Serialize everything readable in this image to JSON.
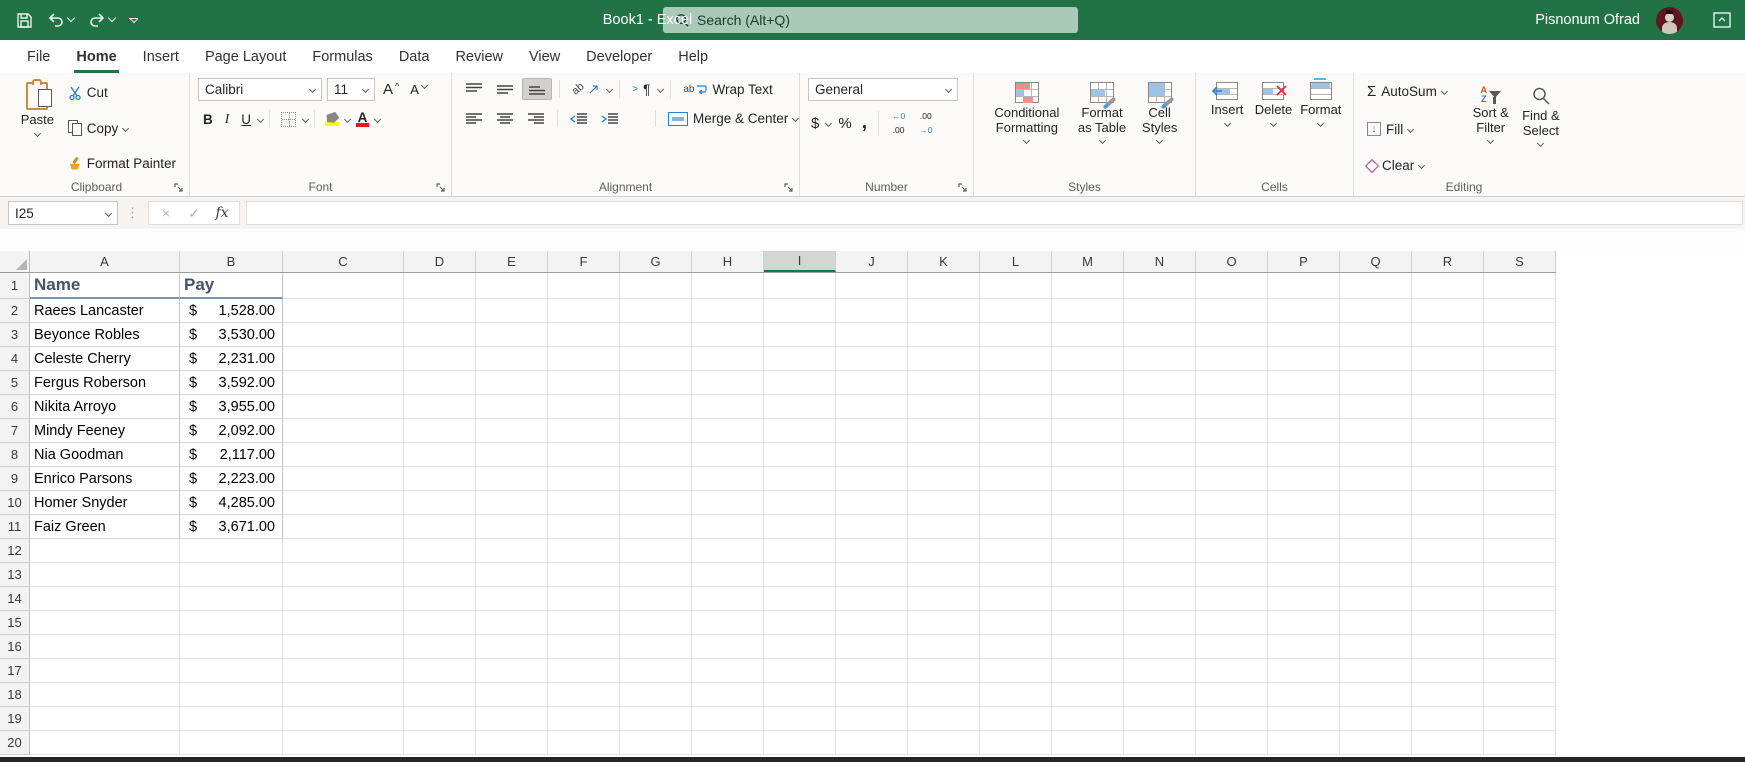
{
  "titlebar": {
    "title": "Book1  -  Excel",
    "search_placeholder": "Search (Alt+Q)",
    "user_name": "Pisnonum Ofrad"
  },
  "tabs": {
    "active": "Home",
    "items": [
      {
        "label": "File"
      },
      {
        "label": "Home"
      },
      {
        "label": "Insert"
      },
      {
        "label": "Page Layout"
      },
      {
        "label": "Formulas"
      },
      {
        "label": "Data"
      },
      {
        "label": "Review"
      },
      {
        "label": "View"
      },
      {
        "label": "Developer"
      },
      {
        "label": "Help"
      }
    ]
  },
  "ribbon": {
    "clipboard": {
      "label": "Clipboard",
      "paste": "Paste",
      "cut": "Cut",
      "copy": "Copy",
      "format_painter": "Format Painter"
    },
    "font": {
      "label": "Font",
      "font_name": "Calibri",
      "font_size": "11"
    },
    "alignment": {
      "label": "Alignment",
      "wrap_text": "Wrap Text",
      "merge_center": "Merge & Center"
    },
    "number": {
      "label": "Number",
      "format": "General"
    },
    "styles": {
      "label": "Styles",
      "conditional_formatting": "Conditional Formatting",
      "format_as_table": "Format as Table",
      "cell_styles": "Cell Styles"
    },
    "cells": {
      "label": "Cells",
      "insert": "Insert",
      "delete": "Delete",
      "format": "Format"
    },
    "editing": {
      "label": "Editing",
      "autosum": "AutoSum",
      "fill": "Fill",
      "clear": "Clear",
      "sort_filter": "Sort & Filter",
      "find_select": "Find & Select"
    }
  },
  "icons": {
    "bold": "B",
    "italic": "I",
    "underline": "U",
    "grow_font": "A",
    "shrink_font": "A",
    "font_color_letter": "A",
    "orientation_text": "ab",
    "pilcrow": "¶",
    "wrap_ab": "ab",
    "currency": "$",
    "percent": "%",
    "comma": ",",
    "inc_dec_top": "←0",
    "inc_dec_bottom": ".00",
    "dec_dec_top": ".00",
    "dec_dec_bottom": "→0",
    "autosum_sigma": "Σ",
    "fill_arrow": "↓",
    "sort_a": "A",
    "sort_z": "Z",
    "cancel": "×",
    "enter": "✓",
    "fx": "fx"
  },
  "formula_bar": {
    "name_box": "I25",
    "formula_value": ""
  },
  "grid": {
    "column_headers": [
      "A",
      "B",
      "C",
      "D",
      "E",
      "F",
      "G",
      "H",
      "I",
      "J",
      "K",
      "L",
      "M",
      "N",
      "O",
      "P",
      "Q",
      "R",
      "S"
    ],
    "selected_column": "I",
    "row_count": 20
  },
  "sheet_data": {
    "header_row": {
      "name": "Name",
      "pay": "Pay"
    },
    "currency_symbol": "$",
    "rows": [
      {
        "row": 2,
        "name": "Raees Lancaster",
        "pay": "1,528.00"
      },
      {
        "row": 3,
        "name": "Beyonce Robles",
        "pay": "3,530.00"
      },
      {
        "row": 4,
        "name": "Celeste Cherry",
        "pay": "2,231.00"
      },
      {
        "row": 5,
        "name": "Fergus Roberson",
        "pay": "3,592.00"
      },
      {
        "row": 6,
        "name": "Nikita Arroyo",
        "pay": "3,955.00"
      },
      {
        "row": 7,
        "name": "Mindy Feeney",
        "pay": "2,092.00"
      },
      {
        "row": 8,
        "name": "Nia Goodman",
        "pay": "2,117.00"
      },
      {
        "row": 9,
        "name": "Enrico Parsons",
        "pay": "2,223.00"
      },
      {
        "row": 10,
        "name": "Homer Snyder",
        "pay": "4,285.00"
      },
      {
        "row": 11,
        "name": "Faiz Green",
        "pay": "3,671.00"
      }
    ]
  },
  "colors": {
    "titlebar_green": "#217346",
    "accent_green": "#107c41",
    "heading_text": "#44546a",
    "search_bg": "#a9cab7"
  }
}
